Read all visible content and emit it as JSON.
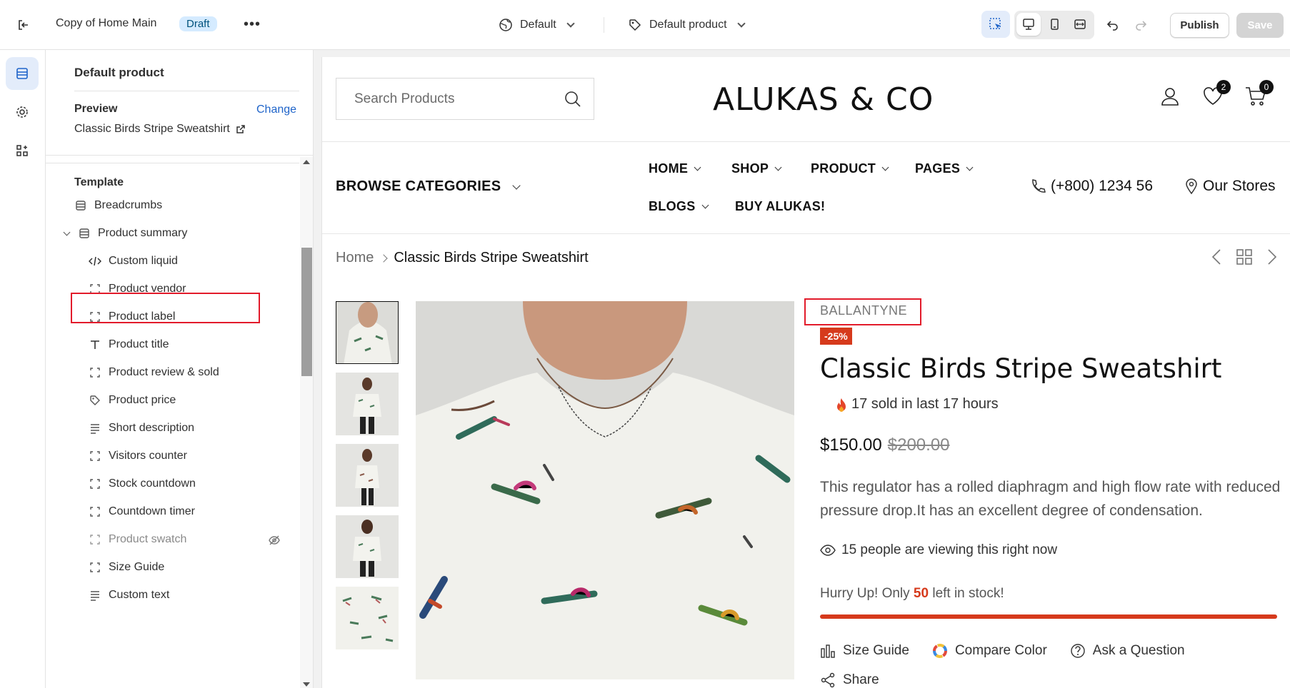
{
  "topbar": {
    "title": "Copy of Home Main",
    "status_badge": "Draft",
    "more_label": "•••",
    "theme_select": "Default",
    "template_select": "Default product",
    "publish_label": "Publish",
    "save_label": "Save"
  },
  "panel": {
    "heading": "Default product",
    "preview_label": "Preview",
    "change_label": "Change",
    "preview_value": "Classic Birds Stripe Sweatshirt",
    "section_title": "Template",
    "items": [
      {
        "label": "Breadcrumbs",
        "icon": "section-icon"
      },
      {
        "label": "Product summary",
        "icon": "section-icon"
      },
      {
        "label": "Custom liquid",
        "icon": "code-icon"
      },
      {
        "label": "Product vendor",
        "icon": "block-icon"
      },
      {
        "label": "Product label",
        "icon": "block-icon"
      },
      {
        "label": "Product title",
        "icon": "text-icon"
      },
      {
        "label": "Product review & sold",
        "icon": "block-icon"
      },
      {
        "label": "Product price",
        "icon": "price-tag-icon"
      },
      {
        "label": "Short description",
        "icon": "paragraph-icon"
      },
      {
        "label": "Visitors counter",
        "icon": "block-icon"
      },
      {
        "label": "Stock countdown",
        "icon": "block-icon"
      },
      {
        "label": "Countdown timer",
        "icon": "block-icon"
      },
      {
        "label": "Product swatch",
        "icon": "block-icon"
      },
      {
        "label": "Size Guide",
        "icon": "block-icon"
      },
      {
        "label": "Custom text",
        "icon": "paragraph-icon"
      }
    ]
  },
  "store": {
    "search_placeholder": "Search Products",
    "logo": "ALUKAS & CO",
    "wishlist_count": "2",
    "cart_count": "0",
    "browse_label": "BROWSE CATEGORIES",
    "nav": [
      "HOME",
      "SHOP",
      "PRODUCT",
      "PAGES",
      "BLOGS",
      "BUY ALUKAS!"
    ],
    "phone": "(+800) 1234 56",
    "stores": "Our Stores",
    "breadcrumb_home": "Home",
    "breadcrumb_current": "Classic Birds Stripe Sweatshirt"
  },
  "product": {
    "vendor": "BALLANTYNE",
    "discount_badge": "-25%",
    "title": "Classic Birds Stripe Sweatshirt",
    "sold_text": "17 sold in last 17 hours",
    "price": "$150.00",
    "compare_price": "$200.00",
    "description": "This regulator has a rolled diaphragm and high flow rate with reduced pressure drop.It has an excellent degree of condensation.",
    "viewers_text": "15 people are viewing this right now",
    "stock_prefix": "Hurry Up! Only ",
    "stock_count": "50",
    "stock_suffix": " left in stock!",
    "stock_fill_fraction": 1.0,
    "size_guide": "Size Guide",
    "compare_color": "Compare Color",
    "ask_question": "Ask a Question",
    "share": "Share"
  },
  "colors": {
    "accent": "#1f64c9",
    "sale": "#d63a1c",
    "highlight": "#e21b2b"
  }
}
